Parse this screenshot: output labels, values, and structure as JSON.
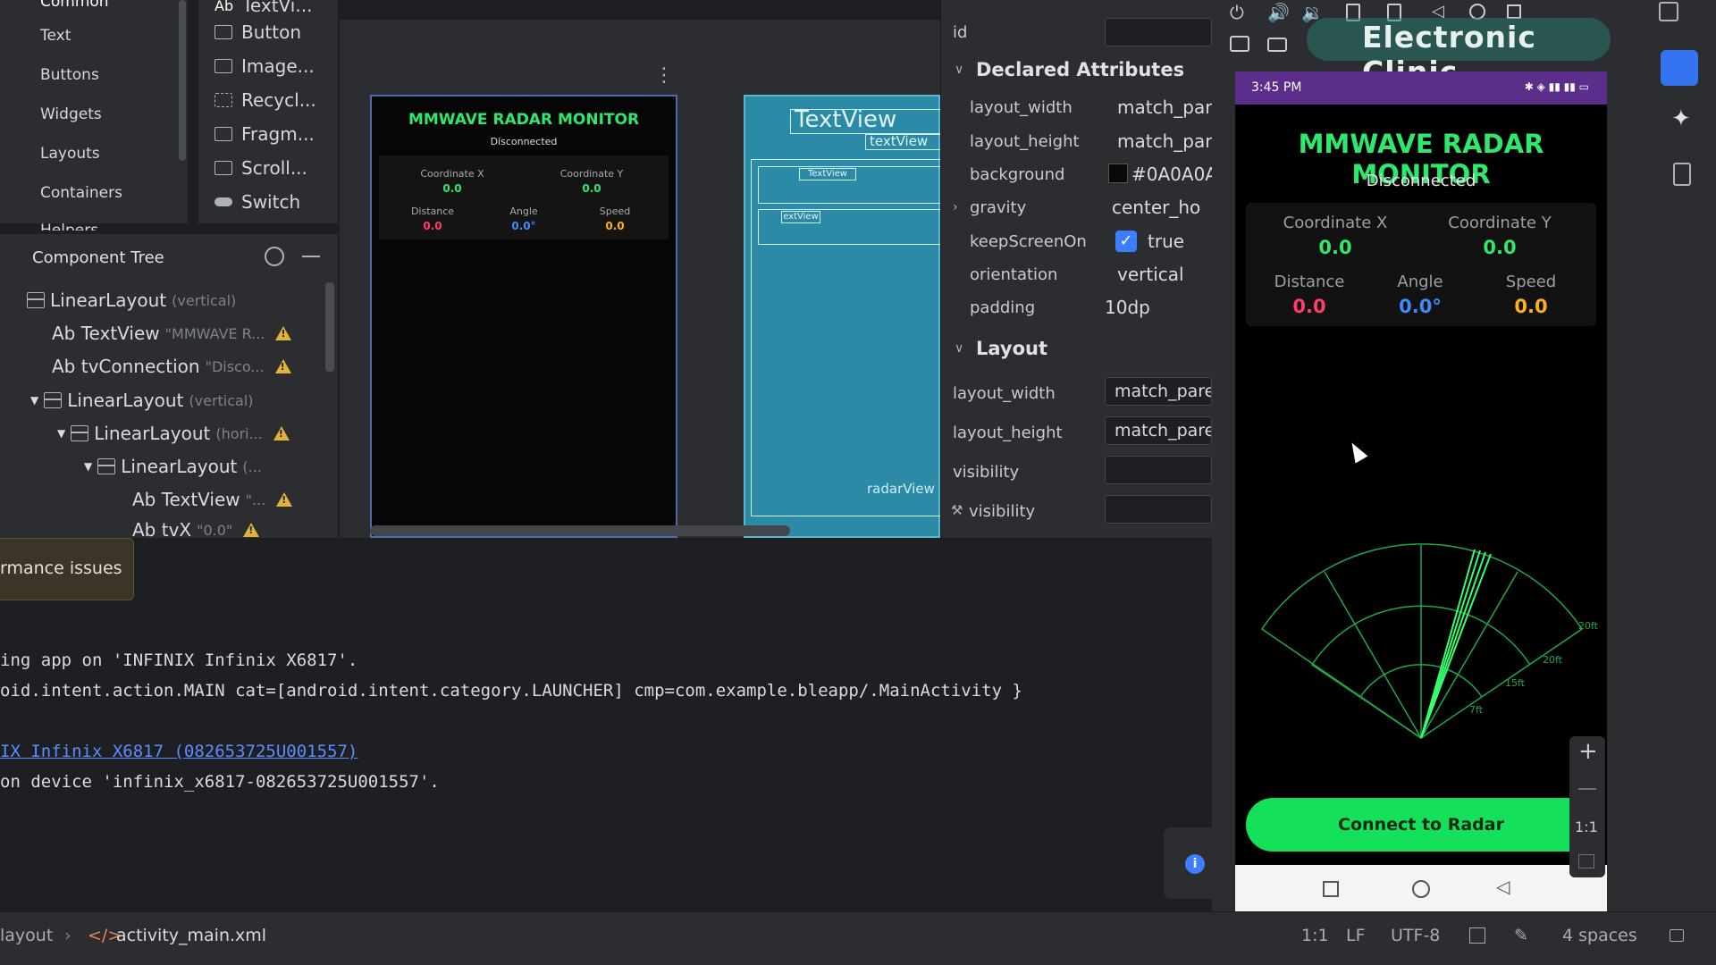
{
  "palette": {
    "categories": [
      "Common",
      "Text",
      "Buttons",
      "Widgets",
      "Layouts",
      "Containers",
      "Helpers"
    ],
    "items": [
      "TextVi...",
      "Button",
      "Image...",
      "Recycl...",
      "Fragm...",
      "Scroll...",
      "Switch"
    ]
  },
  "tree": {
    "title": "Component Tree",
    "rows": [
      {
        "label": "LinearLayout",
        "sub": "(vertical)"
      },
      {
        "label": "Ab TextView",
        "sub": "\"MMWAVE R..."
      },
      {
        "label": "Ab tvConnection",
        "sub": "\"Disco..."
      },
      {
        "label": "LinearLayout",
        "sub": "(vertical)"
      },
      {
        "label": "LinearLayout",
        "sub": "(hori..."
      },
      {
        "label": "LinearLayout",
        "sub": "(..."
      },
      {
        "label": "Ab TextView",
        "sub": "\"..."
      },
      {
        "label": "Ab tvX",
        "sub": "\"0.0\""
      }
    ]
  },
  "toast": {
    "text": "rmance issues"
  },
  "design": {
    "title": "MMWAVE RADAR MONITOR",
    "status": "Disconnected",
    "coord_x_label": "Coordinate X",
    "coord_x": "0.0",
    "coord_y_label": "Coordinate Y",
    "coord_y": "0.0",
    "distance_label": "Distance",
    "distance": "0.0",
    "angle_label": "Angle",
    "angle": "0.0°",
    "speed_label": "Speed",
    "speed": "0.0"
  },
  "blueprint": {
    "textview1": "TextView",
    "textview2": "textView",
    "textview3": "TextView",
    "textview4": "extView",
    "radar_label": "radarView"
  },
  "attributes": {
    "id_label": "id",
    "declared_title": "Declared Attributes",
    "declared": [
      {
        "name": "layout_width",
        "value": "match_pare"
      },
      {
        "name": "layout_height",
        "value": "match_pare"
      },
      {
        "name": "background",
        "value": "#0A0A0A"
      },
      {
        "name": "gravity",
        "value": "center_ho"
      },
      {
        "name": "keepScreenOn",
        "value": "true"
      },
      {
        "name": "orientation",
        "value": "vertical"
      },
      {
        "name": "padding",
        "value": "10dp"
      }
    ],
    "layout_title": "Layout",
    "layout": [
      {
        "name": "layout_width",
        "value": "match_pare"
      },
      {
        "name": "layout_height",
        "value": "match_pare"
      },
      {
        "name": "visibility",
        "value": ""
      },
      {
        "name": "visibility",
        "value": ""
      }
    ]
  },
  "phone": {
    "time": "3:45 PM",
    "title": "MMWAVE RADAR MONITOR",
    "status": "Disconnected",
    "coord_x_label": "Coordinate X",
    "coord_x": "0.0",
    "coord_y_label": "Coordinate Y",
    "coord_y": "0.0",
    "distance_label": "Distance",
    "distance": "0.0",
    "angle_label": "Angle",
    "angle": "0.0°",
    "speed_label": "Speed",
    "speed": "0.0",
    "radar_labels": [
      "20ft",
      "20ft",
      "15ft",
      "7ft"
    ],
    "connect_label": "Connect to Radar"
  },
  "emulator": {
    "watermark": "Electronic Clinic",
    "zoom_label": "1:1"
  },
  "log": {
    "lines": [
      "ing app on 'INFINIX Infinix X6817'.",
      "oid.intent.action.MAIN cat=[android.intent.category.LAUNCHER] cmp=com.example.bleapp/.MainActivity }",
      "IX Infinix X6817 (082653725U001557)",
      "on device 'infinix_x6817-082653725U001557'."
    ]
  },
  "statusbar": {
    "crumb1": "layout",
    "crumb2": "activity_main.xml",
    "position": "1:1",
    "line_sep": "LF",
    "encoding": "UTF-8",
    "indent": "4 spaces"
  },
  "colors": {
    "accent": "#2ee86b",
    "distance": "#ff3d6a",
    "angle": "#3d8bff",
    "speed": "#ffb020",
    "status_bar": "#5a2e8a"
  }
}
